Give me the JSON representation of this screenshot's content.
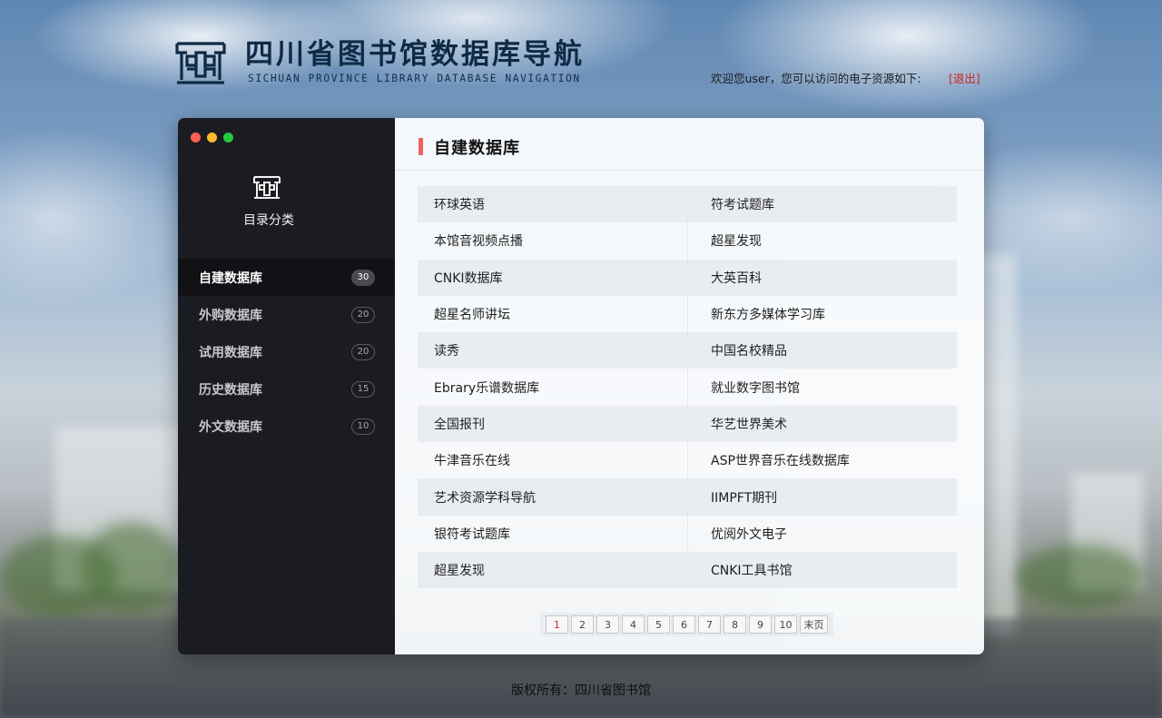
{
  "header": {
    "title": "四川省图书馆数据库导航",
    "subtitle": "SICHUAN PROVINCE LIBRARY DATABASE NAVIGATION",
    "welcome_text": "欢迎您user，您可以访问的电子资源如下:",
    "logout_label": "[退出]"
  },
  "sidebar": {
    "title": "目录分类",
    "items": [
      {
        "label": "自建数据库",
        "count": "30"
      },
      {
        "label": "外购数据库",
        "count": "20"
      },
      {
        "label": "试用数据库",
        "count": "20"
      },
      {
        "label": "历史数据库",
        "count": "15"
      },
      {
        "label": "外文数据库",
        "count": "10"
      }
    ]
  },
  "main": {
    "title": "自建数据库",
    "rows": [
      {
        "left": "环球英语",
        "right": "符考试题库"
      },
      {
        "left": "本馆音视频点播",
        "right": "超星发现"
      },
      {
        "left": "CNKI数据库",
        "right": "大英百科"
      },
      {
        "left": "超星名师讲坛",
        "right": "新东方多媒体学习库"
      },
      {
        "left": "读秀",
        "right": "中国名校精品"
      },
      {
        "left": "Ebrary乐谱数据库",
        "right": "就业数字图书馆"
      },
      {
        "left": "全国报刊",
        "right": "华艺世界美术"
      },
      {
        "left": "牛津音乐在线",
        "right": "ASP世界音乐在线数据库"
      },
      {
        "left": "艺术资源学科导航",
        "right": "IIMPFT期刊"
      },
      {
        "left": "银符考试题库",
        "right": "优阅外文电子"
      },
      {
        "left": "超星发现",
        "right": "CNKI工具书馆"
      }
    ]
  },
  "pagination": {
    "pages": [
      "1",
      "2",
      "3",
      "4",
      "5",
      "6",
      "7",
      "8",
      "9",
      "10"
    ],
    "current": "1",
    "last_label": "末页"
  },
  "footer": {
    "copyright": "版权所有：四川省图书馆"
  },
  "colors": {
    "accent_bar": "#f0645f",
    "logout": "#d42020",
    "window_dot_red": "#ff5f57",
    "window_dot_yellow": "#febc2e",
    "window_dot_green": "#28c840"
  },
  "icons": {
    "logo": "library-building-icon",
    "category": "library-building-icon"
  }
}
